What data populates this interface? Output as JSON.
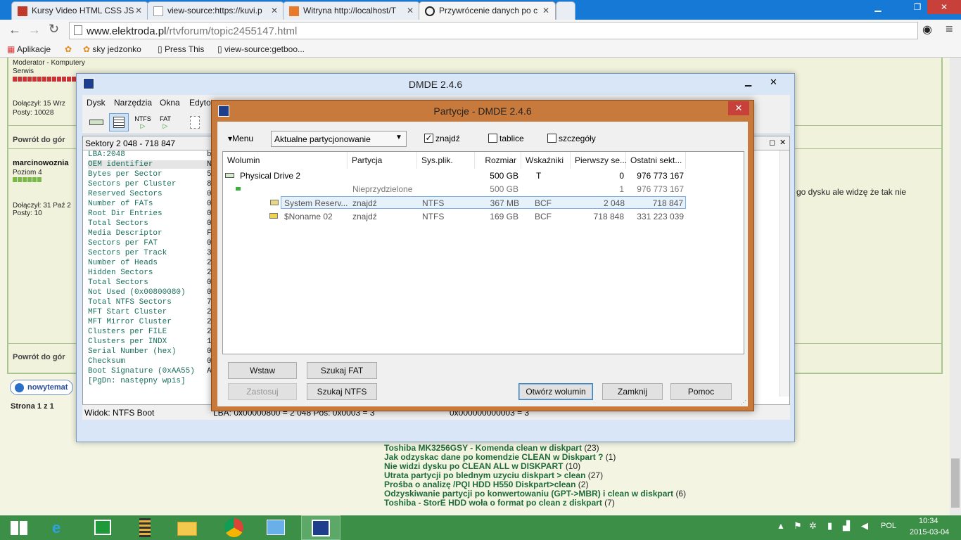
{
  "browser": {
    "tabs": [
      {
        "label": "Kursy Video HTML CSS JS"
      },
      {
        "label": "view-source:https://kuvi.p"
      },
      {
        "label": "Witryna http://localhost/T"
      },
      {
        "label": "Przywrócenie danych po c"
      }
    ],
    "url_host": "www.elektroda.pl",
    "url_path": "/rtvforum/topic2455147.html",
    "bookmarks": [
      "Aplikacje",
      "",
      "sky jedzonko",
      "Press This",
      "view-source:getboo..."
    ]
  },
  "forum": {
    "moderator": "Moderator - Komputery",
    "serwis": "Serwis",
    "joined1": "Dołączył: 15 Wrz",
    "posts1": "Posty: 10028",
    "back_top": "Powrót do gór",
    "user2": "marcinowoznia",
    "level2": "Poziom 4",
    "joined2": "Dołączył: 31 Paź 2",
    "posts2": "Posty: 10",
    "post_fragment": "go dysku ale widzę że tak nie",
    "back_top2": "Powrót do gór",
    "new_topic": "nowytemat",
    "page_info": "Strona 1 z 1",
    "related": [
      {
        "title": "Toshiba MK3256GSY - Komenda clean w diskpart",
        "count": "(23)"
      },
      {
        "title": "Jak odzyskac dane po komendzie CLEAN w Diskpart ?",
        "count": "(1)"
      },
      {
        "title": "Nie widzi dysku po CLEAN ALL w DISKPART",
        "count": "(10)"
      },
      {
        "title": "Utrata partycji po blednym uzyciu diskpart > clean",
        "count": "(27)"
      },
      {
        "title": "Prośba o analizę /PQI HDD H550 Diskpart>clean",
        "count": "(2)"
      },
      {
        "title": "Odzyskiwanie partycji po konwertowaniu (GPT->MBR) i clean w diskpart",
        "count": "(6)"
      },
      {
        "title": "Toshiba - StorE HDD woła o format po clean z diskpart",
        "count": "(7)"
      }
    ]
  },
  "dmde": {
    "title": "DMDE 2.4.6",
    "menu": [
      "Dysk",
      "Narzędzia",
      "Okna",
      "Edytor"
    ],
    "tool_ntfs": "NTFS",
    "tool_fat": "FAT",
    "sectors_header": "Sektory 2 048 - 718 847",
    "fields": [
      "LBA:2048",
      "OEM identifier",
      "Bytes per Sector",
      "Sectors per Cluster",
      "Reserved Sectors",
      "Number of FATs",
      "Root Dir Entries",
      "Total Sectors",
      "Media Descriptor",
      "Sectors per FAT",
      "Sectors per Track",
      "Number of Heads",
      "Hidden Sectors",
      "Total Sectors",
      "Not Used (0x00800080)",
      "Total NTFS Sectors",
      "MFT Start Cluster",
      "MFT Mirror Cluster",
      "Clusters per FILE",
      "Clusters per INDX",
      "Serial Number (hex)",
      "Checksum",
      "Boot Signature (0xAA55)",
      "[PgDn: następny wpis]"
    ],
    "values_col": [
      "bl",
      "N",
      "5",
      "8",
      "0",
      "0",
      "0",
      "0",
      "F",
      "0",
      "3",
      "2",
      "2",
      "0",
      "0",
      "7",
      "2",
      "2",
      "2",
      "1",
      "0",
      "0",
      "A",
      ""
    ],
    "view": "Widok: NTFS Boot",
    "status_mid": "LBA: 0x00000800 = 2 048  Pos: 0x0003 = 3",
    "status_right": "0x000000000003 = 3"
  },
  "dialog": {
    "title": "Partycje - DMDE 2.4.6",
    "menu_label": "Menu",
    "dropdown_value": "Aktualne partycjonowanie",
    "chk_found": "znajdź",
    "chk_tables": "tablice",
    "chk_details": "szczegóły",
    "columns": [
      "Wolumin",
      "Partycja",
      "Sys.plik.",
      "Rozmiar",
      "Wskaźniki",
      "Pierwszy se...",
      "Ostatni sekt..."
    ],
    "rows": [
      {
        "wolumin": "Physical Drive 2",
        "partycja": "",
        "sys": "",
        "rozmiar": "500 GB",
        "wsk": "T",
        "first": "0",
        "last": "976 773 167"
      },
      {
        "wolumin": "",
        "partycja": "Nieprzydzielone",
        "sys": "",
        "rozmiar": "500 GB",
        "wsk": "",
        "first": "1",
        "last": "976 773 167"
      },
      {
        "wolumin": "System Reserv...",
        "partycja": "znajdź",
        "sys": "NTFS",
        "rozmiar": "367 MB",
        "wsk": "BCF",
        "first": "2 048",
        "last": "718 847"
      },
      {
        "wolumin": "$Noname 02",
        "partycja": "znajdź",
        "sys": "NTFS",
        "rozmiar": "169 GB",
        "wsk": "BCF",
        "first": "718 848",
        "last": "331 223 039"
      }
    ],
    "btn_insert": "Wstaw",
    "btn_fat": "Szukaj FAT",
    "btn_apply": "Zastosuj",
    "btn_ntfs": "Szukaj NTFS",
    "btn_open": "Otwórz wolumin",
    "btn_close": "Zamknij",
    "btn_help": "Pomoc"
  },
  "taskbar": {
    "lang": "POL",
    "time": "10:34",
    "date": "2015-03-04"
  }
}
